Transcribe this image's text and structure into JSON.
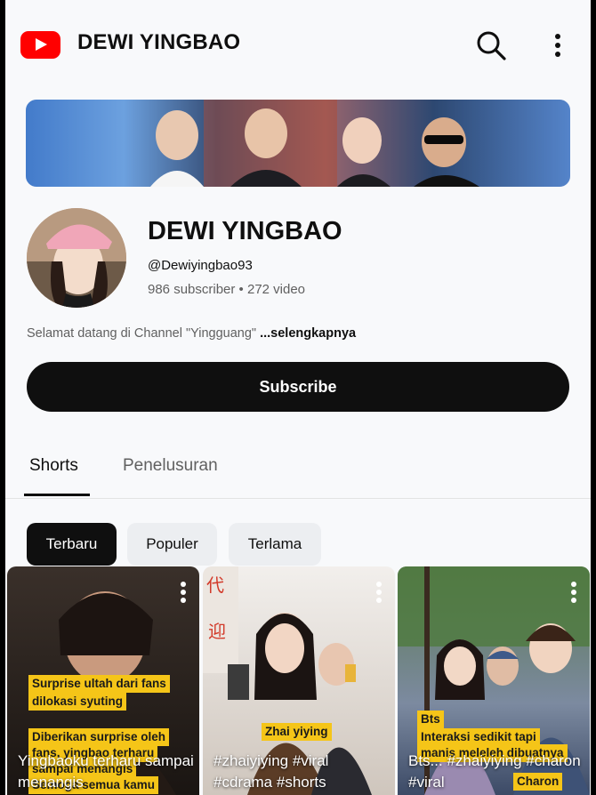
{
  "header": {
    "app_icon": "youtube-logo",
    "title": "DEWI YINGBAO",
    "search_icon": "search-icon",
    "more_icon": "more-vert-icon"
  },
  "channel": {
    "name": "DEWI YINGBAO",
    "handle": "@Dewiyingbao93",
    "stats": "986 subscriber • 272 video",
    "description": "Selamat datang di Channel \"Yingguang\" ",
    "description_more": "...selengkapnya",
    "subscribe_label": "Subscribe"
  },
  "tabs": [
    {
      "label": "Shorts",
      "selected": true
    },
    {
      "label": "Penelusuran",
      "selected": false
    }
  ],
  "chips": [
    {
      "label": "Terbaru",
      "selected": true
    },
    {
      "label": "Populer",
      "selected": false
    },
    {
      "label": "Terlama",
      "selected": false
    }
  ],
  "shorts": [
    {
      "captions": [
        "Surprise ultah dari fans",
        "dilokasi syuting",
        "Diberikan surprise oleh",
        "fans, yingbao terharu",
        "sampai menangis",
        "Semoga semua kamu"
      ],
      "title": "Yingbaoku terharu sampai menangis"
    },
    {
      "captions": [
        "Zhai yiying"
      ],
      "title": "#zhaiyiying #viral #cdrama #shorts"
    },
    {
      "captions": [
        "Bts",
        "Interaksi sedikit tapi",
        "manis meleleh dibuatnya",
        "Charon"
      ],
      "title": "Bts... #zhaiyiying #charon #viral"
    }
  ],
  "colors": {
    "brand_red": "#ff0000",
    "primary_text": "#0f0f0f",
    "secondary_text": "#606060",
    "caption_yellow": "#f5c518"
  }
}
